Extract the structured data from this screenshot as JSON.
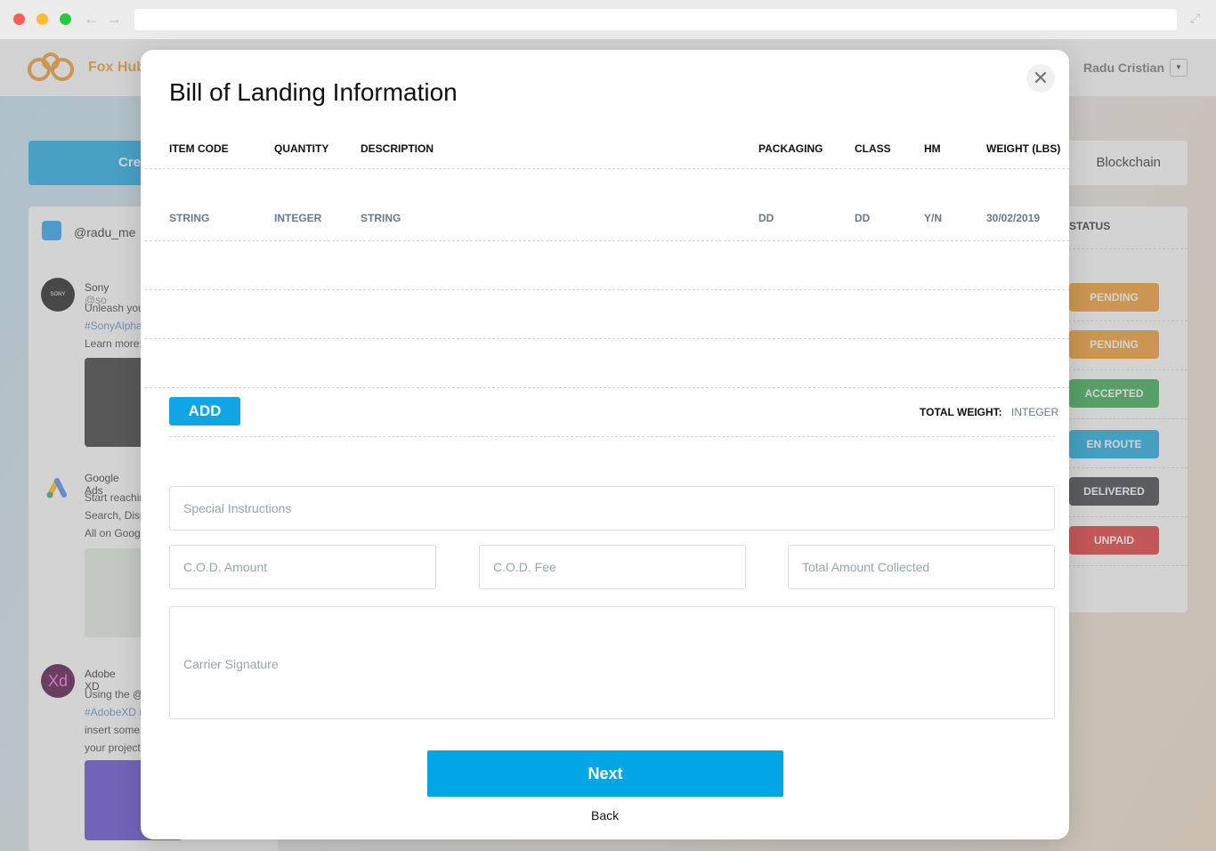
{
  "app": {
    "brand": "Fox Hub",
    "user_name": "Radu Cristian",
    "user_dropdown_glyph": "▼",
    "create_label": "Cre",
    "blockchain_label": "Blockchain",
    "feed": {
      "handle": "@radu_me",
      "items": [
        {
          "name": "Sony",
          "handle": "@so",
          "avatar_text": "SONY",
          "lines": [
            "Unleash you",
            "#SonyAlpha",
            "Learn more:"
          ]
        },
        {
          "name": "Google Ads",
          "lines": [
            "Start reachin",
            "Search, Disp",
            "All on Goog"
          ]
        },
        {
          "name": "Adobe XD",
          "avatar_text": "Xd",
          "lines": [
            "Using the @",
            "#AdobeXD i",
            "insert some",
            "your project"
          ]
        }
      ]
    },
    "status": {
      "header": "STATUS",
      "badges": [
        {
          "label": "PENDING",
          "color": "#f0961f"
        },
        {
          "label": "PENDING",
          "color": "#f0961f"
        },
        {
          "label": "ACCEPTED",
          "color": "#28a745"
        },
        {
          "label": "EN ROUTE",
          "color": "#0aa5e0"
        },
        {
          "label": "DELIVERED",
          "color": "#2f3338"
        },
        {
          "label": "UNPAID",
          "color": "#e02a2a"
        }
      ]
    }
  },
  "modal": {
    "title": "Bill of Landing Information",
    "close_glyph": "✕",
    "columns": {
      "item_code": "ITEM CODE",
      "quantity": "QUANTITY",
      "description": "DESCRIPTION",
      "packaging": "PACKAGING",
      "class": "CLASS",
      "hm": "HM",
      "weight": "WEIGHT (LBS)"
    },
    "row": {
      "item_code": "STRING",
      "quantity": "INTEGER",
      "description": "STRING",
      "packaging": "DD",
      "class": "DD",
      "hm": "Y/N",
      "weight": "30/02/2019"
    },
    "add_label": "ADD",
    "total_weight_label": "TOTAL WEIGHT:",
    "total_weight_value": "INTEGER",
    "fields": {
      "special_instructions": "Special Instructions",
      "cod_amount": "C.O.D. Amount",
      "cod_fee": "C.O.D. Fee",
      "total_amount": "Total Amount Collected",
      "carrier_signature": "Carrier Signature"
    },
    "next_label": "Next",
    "back_label": "Back"
  },
  "colors": {
    "accent": "#00a5e6",
    "brand": "#f29422"
  }
}
